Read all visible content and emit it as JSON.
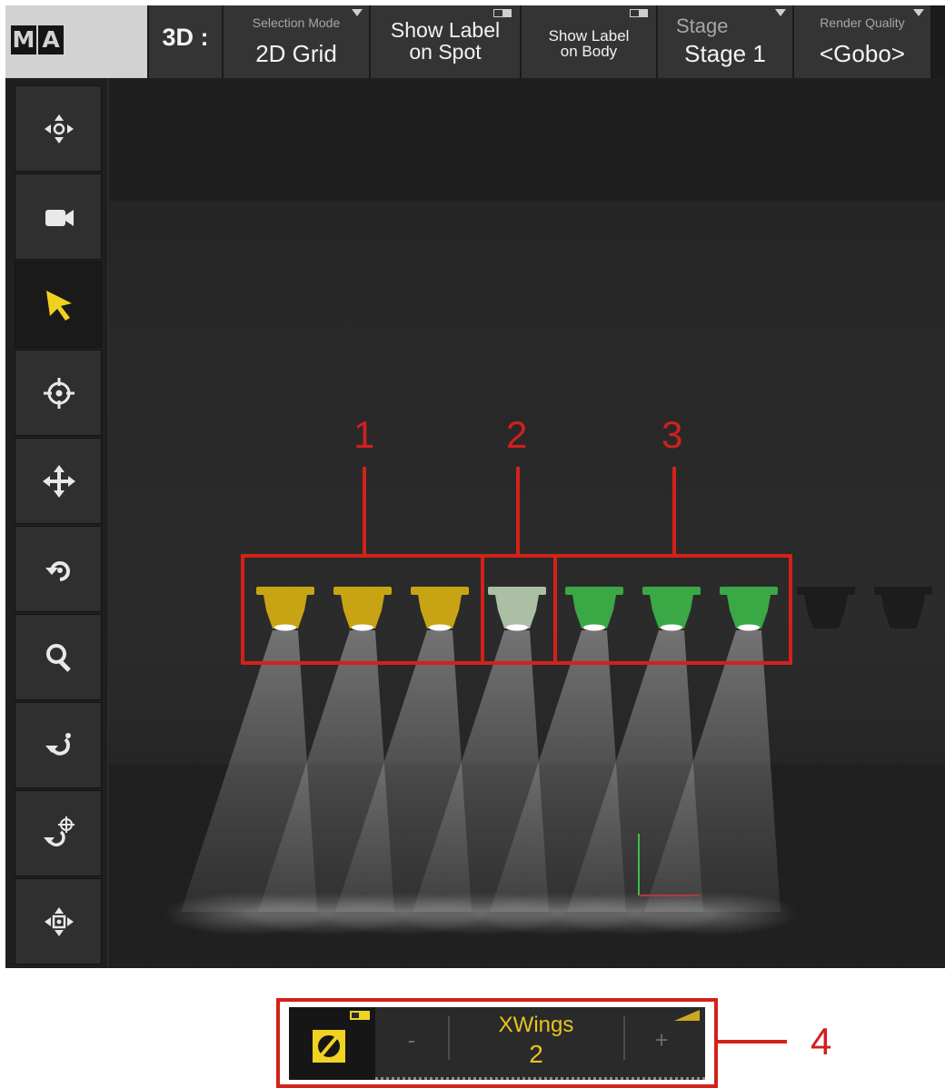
{
  "app": {
    "logo_letters": [
      "M",
      "A"
    ]
  },
  "toolbar": {
    "view_button": "3D :",
    "selection_mode": {
      "caption": "Selection Mode",
      "value": "2D Grid"
    },
    "show_label_on_spot": {
      "line1": "Show Label",
      "line2": "on Spot"
    },
    "show_label_on_body": {
      "line1": "Show Label",
      "line2": "on Body"
    },
    "stage": {
      "caption": "Stage",
      "value": "Stage 1"
    },
    "render_quality": {
      "caption": "Render Quality",
      "value": "<Gobo>"
    }
  },
  "tools": [
    {
      "name": "move-view-tool",
      "icon": "arrows-cross-icon"
    },
    {
      "name": "camera-tool",
      "icon": "camera-icon"
    },
    {
      "name": "select-tool",
      "icon": "cursor-arrow-icon",
      "active": true
    },
    {
      "name": "target-tool",
      "icon": "crosshair-icon"
    },
    {
      "name": "move-tool",
      "icon": "move-arrows-icon"
    },
    {
      "name": "rotate-tool",
      "icon": "rotate-icon"
    },
    {
      "name": "zoom-tool",
      "icon": "magnifier-icon"
    },
    {
      "name": "orbit-tool",
      "icon": "orbit-icon"
    },
    {
      "name": "orbit-target-tool",
      "icon": "orbit-target-icon"
    },
    {
      "name": "center-view-tool",
      "icon": "arrows-center-icon"
    }
  ],
  "viewport": {
    "fixtures": [
      {
        "group": 1,
        "color": "#c8a414"
      },
      {
        "group": 1,
        "color": "#c8a414"
      },
      {
        "group": 1,
        "color": "#c8a414"
      },
      {
        "group": 2,
        "color": "#aabfa4"
      },
      {
        "group": 3,
        "color": "#3aa845"
      },
      {
        "group": 3,
        "color": "#3aa845"
      },
      {
        "group": 3,
        "color": "#3aa845"
      },
      {
        "group": 0,
        "color": "#1c1c1c"
      },
      {
        "group": 0,
        "color": "#1c1c1c"
      }
    ],
    "group_labels": [
      "1",
      "2",
      "3"
    ]
  },
  "encoder": {
    "name": "XWings",
    "value": "2",
    "minus": "-",
    "plus": "+"
  },
  "callout_4": "4",
  "colors": {
    "callout": "#d32219",
    "encoder_text": "#e6c420",
    "selection_highlight": "#f0d223"
  }
}
